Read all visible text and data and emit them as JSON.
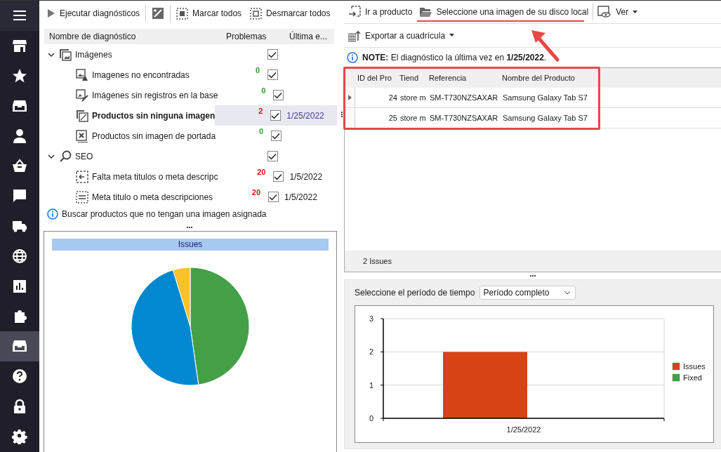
{
  "sidebar": {
    "items": [
      {
        "selected": false
      },
      {
        "selected": false
      },
      {
        "selected": false
      },
      {
        "selected": false
      },
      {
        "selected": false
      },
      {
        "selected": false
      },
      {
        "selected": false
      },
      {
        "selected": false
      },
      {
        "selected": false
      },
      {
        "selected": false
      },
      {
        "selected": false
      },
      {
        "selected": true
      },
      {
        "selected": false
      },
      {
        "selected": false
      },
      {
        "selected": false
      }
    ]
  },
  "left_toolbar": {
    "run": "Ejecutar diagnósticos",
    "mark_all": "Marcar todos",
    "unmark_all": "Desmarcar todos"
  },
  "tree": {
    "columns": [
      "Nombre de diagnóstico",
      "Problemas",
      "Última e..."
    ],
    "groups": [
      {
        "label": "Imágenes",
        "kind": "images",
        "expanded": true,
        "checked": true,
        "children": [
          {
            "label": "Imagenes no encontradas",
            "kind": "missing",
            "problems": "0",
            "color": "#2e9e2e",
            "checked": true,
            "selected": false
          },
          {
            "label": "Imágenes sin registros en la base",
            "kind": "unregistered",
            "problems": "0",
            "color": "#2e9e2e",
            "checked": true,
            "selected": false
          },
          {
            "label": "Productos sin ninguna imagen",
            "kind": "noimage",
            "problems": "2",
            "color": "#e01010",
            "checked": true,
            "date": "1/25/2022",
            "selected": true
          },
          {
            "label": "Productos sin imagen de portada",
            "kind": "nocover",
            "problems": "0",
            "color": "#2e9e2e",
            "checked": true,
            "selected": false
          }
        ]
      },
      {
        "label": "SEO",
        "kind": "seo",
        "expanded": true,
        "checked": true,
        "children": [
          {
            "label": "Falta meta titulos o meta descripc",
            "kind": "metamissing",
            "problems": "20",
            "color": "#e01010",
            "checked": true,
            "date": "1/5/2022",
            "selected": false
          },
          {
            "label": "Meta titulo o meta descripciones",
            "kind": "metalist",
            "problems": "20",
            "color": "#e01010",
            "checked": true,
            "date": "1/5/2022",
            "selected": false
          }
        ]
      }
    ]
  },
  "info": "Buscar productos que no tengan una imagen asignada",
  "pie_panel": {
    "title": "Issues",
    "kind": "picture"
  },
  "right_toolbar": {
    "goto": "Ir a producto",
    "select_image": "Seleccione una imagen de su disco local",
    "view": "Ver",
    "export": "Exportar a cuadrícula"
  },
  "note": "**NOTE:** El diagnóstico la última vez en **1/25/2022**.",
  "grid": {
    "columns": [
      "ID del Pro",
      "Tiend",
      "Referencia",
      "Nombre del Producto"
    ],
    "rows": [
      {
        "id": "24",
        "store": "store m",
        "reference": "SM-T730NZSAXAR",
        "name": "Samsung Galaxy Tab S7",
        "selected": true
      },
      {
        "id": "25",
        "store": "store m",
        "reference": "SM-T730NZSAXAR",
        "name": "Samsung Galaxy Tab S7",
        "selected": false
      }
    ],
    "footer": "2 Issues"
  },
  "period": {
    "label": "Seleccione el período de tiempo",
    "value": "Período completo"
  },
  "bar_chart": {
    "chart_data": {
      "type": "bar",
      "categories": [
        "1/25/2022"
      ],
      "series": [
        {
          "name": "Issues",
          "color": "#d84315",
          "values": [
            2
          ]
        },
        {
          "name": "Fixed",
          "color": "#43a047",
          "values": [
            0
          ]
        }
      ],
      "ylim": [
        0,
        3
      ],
      "yticks": [
        0,
        1,
        2,
        3
      ]
    }
  }
}
